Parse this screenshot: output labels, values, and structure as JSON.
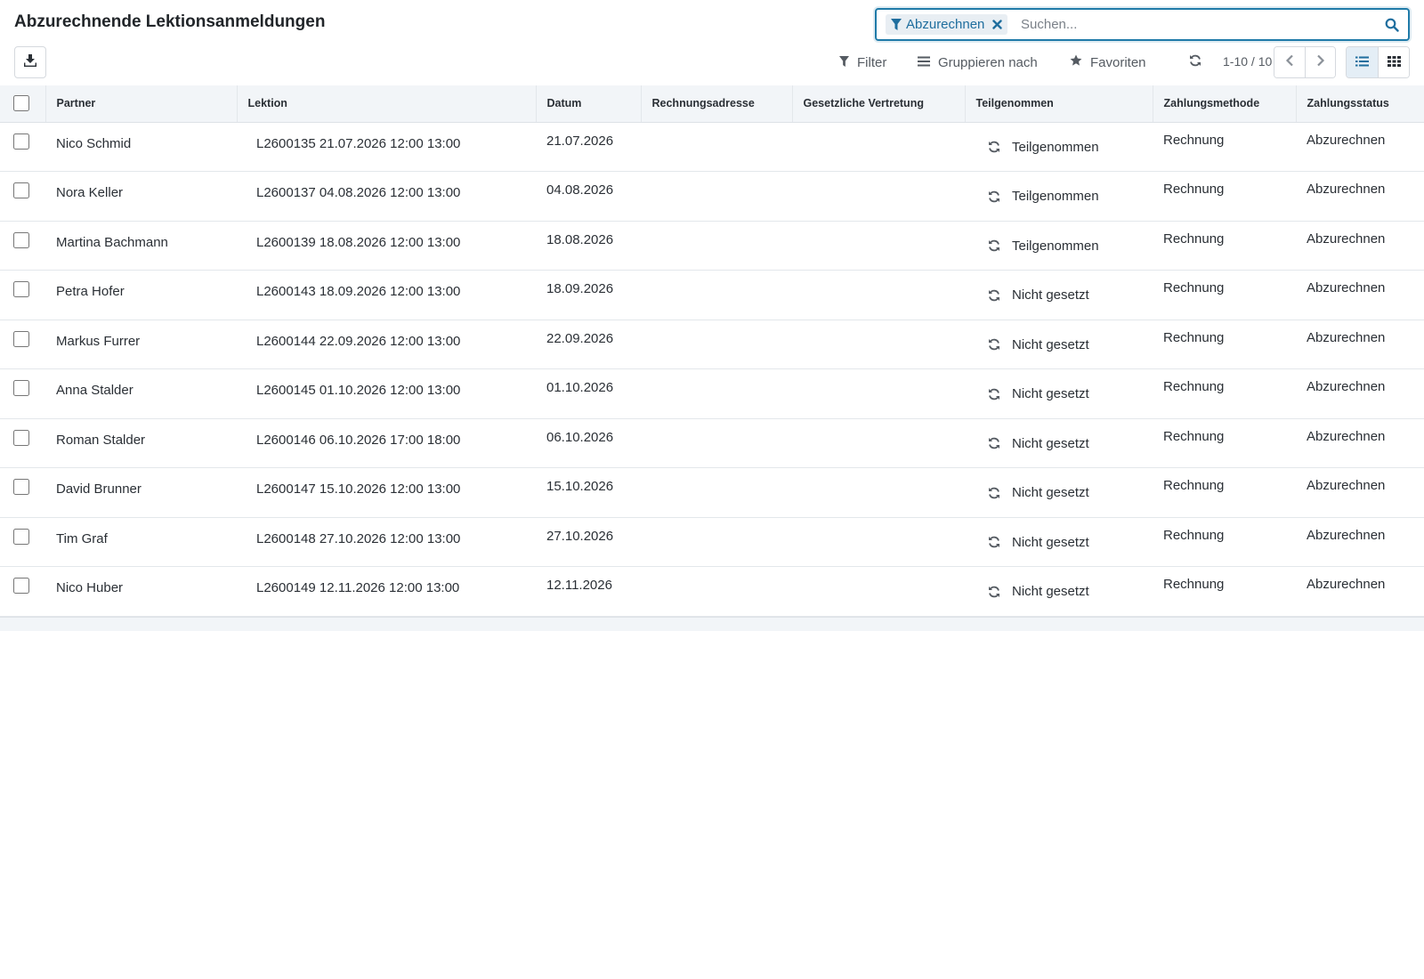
{
  "header": {
    "title": "Abzurechnende Lektionsanmeldungen"
  },
  "search": {
    "facet_label": "Abzurechnen",
    "placeholder": "Suchen..."
  },
  "toolbar": {
    "filter_label": "Filter",
    "group_label": "Gruppieren nach",
    "favorites_label": "Favoriten",
    "pager_text": "1-10 / 10"
  },
  "table": {
    "columns": [
      "Partner",
      "Lektion",
      "Datum",
      "Rechnungsadresse",
      "Gesetzliche Vertretung",
      "Teilgenommen",
      "Zahlungsmethode",
      "Zahlungsstatus"
    ],
    "rows": [
      {
        "partner": "Nico Schmid",
        "lektion": "L2600135 21.07.2026 12:00 13:00",
        "datum": "21.07.2026",
        "rechnungsadresse": "",
        "vertretung": "",
        "teilgenommen": "Teilgenommen",
        "zahlungsmethode": "Rechnung",
        "zahlungsstatus": "Abzurechnen"
      },
      {
        "partner": "Nora Keller",
        "lektion": "L2600137 04.08.2026 12:00 13:00",
        "datum": "04.08.2026",
        "rechnungsadresse": "",
        "vertretung": "",
        "teilgenommen": "Teilgenommen",
        "zahlungsmethode": "Rechnung",
        "zahlungsstatus": "Abzurechnen"
      },
      {
        "partner": "Martina Bachmann",
        "lektion": "L2600139 18.08.2026 12:00 13:00",
        "datum": "18.08.2026",
        "rechnungsadresse": "",
        "vertretung": "",
        "teilgenommen": "Teilgenommen",
        "zahlungsmethode": "Rechnung",
        "zahlungsstatus": "Abzurechnen"
      },
      {
        "partner": "Petra Hofer",
        "lektion": "L2600143 18.09.2026 12:00 13:00",
        "datum": "18.09.2026",
        "rechnungsadresse": "",
        "vertretung": "",
        "teilgenommen": "Nicht gesetzt",
        "zahlungsmethode": "Rechnung",
        "zahlungsstatus": "Abzurechnen"
      },
      {
        "partner": "Markus Furrer",
        "lektion": "L2600144 22.09.2026 12:00 13:00",
        "datum": "22.09.2026",
        "rechnungsadresse": "",
        "vertretung": "",
        "teilgenommen": "Nicht gesetzt",
        "zahlungsmethode": "Rechnung",
        "zahlungsstatus": "Abzurechnen"
      },
      {
        "partner": "Anna Stalder",
        "lektion": "L2600145 01.10.2026 12:00 13:00",
        "datum": "01.10.2026",
        "rechnungsadresse": "",
        "vertretung": "",
        "teilgenommen": "Nicht gesetzt",
        "zahlungsmethode": "Rechnung",
        "zahlungsstatus": "Abzurechnen"
      },
      {
        "partner": "Roman Stalder",
        "lektion": "L2600146 06.10.2026 17:00 18:00",
        "datum": "06.10.2026",
        "rechnungsadresse": "",
        "vertretung": "",
        "teilgenommen": "Nicht gesetzt",
        "zahlungsmethode": "Rechnung",
        "zahlungsstatus": "Abzurechnen"
      },
      {
        "partner": "David Brunner",
        "lektion": "L2600147 15.10.2026 12:00 13:00",
        "datum": "15.10.2026",
        "rechnungsadresse": "",
        "vertretung": "",
        "teilgenommen": "Nicht gesetzt",
        "zahlungsmethode": "Rechnung",
        "zahlungsstatus": "Abzurechnen"
      },
      {
        "partner": "Tim Graf",
        "lektion": "L2600148 27.10.2026 12:00 13:00",
        "datum": "27.10.2026",
        "rechnungsadresse": "",
        "vertretung": "",
        "teilgenommen": "Nicht gesetzt",
        "zahlungsmethode": "Rechnung",
        "zahlungsstatus": "Abzurechnen"
      },
      {
        "partner": "Nico Huber",
        "lektion": "L2600149 12.11.2026 12:00 13:00",
        "datum": "12.11.2026",
        "rechnungsadresse": "",
        "vertretung": "",
        "teilgenommen": "Nicht gesetzt",
        "zahlungsmethode": "Rechnung",
        "zahlungsstatus": "Abzurechnen"
      }
    ]
  },
  "colors": {
    "accent": "#1f6e9e",
    "header_bg": "#f2f5f8",
    "active_view_bg": "#e4eef6"
  },
  "icons": {
    "facet": "filter-icon",
    "facet_remove": "close-icon",
    "search": "search-icon",
    "download": "download-icon",
    "filter": "filter-icon",
    "group": "list-lines-icon",
    "favorites": "star-icon",
    "refresh": "refresh-icon",
    "prev": "chevron-left-icon",
    "next": "chevron-right-icon",
    "list_view": "list-view-icon",
    "kanban_view": "grid-view-icon",
    "status": "refresh-icon"
  }
}
